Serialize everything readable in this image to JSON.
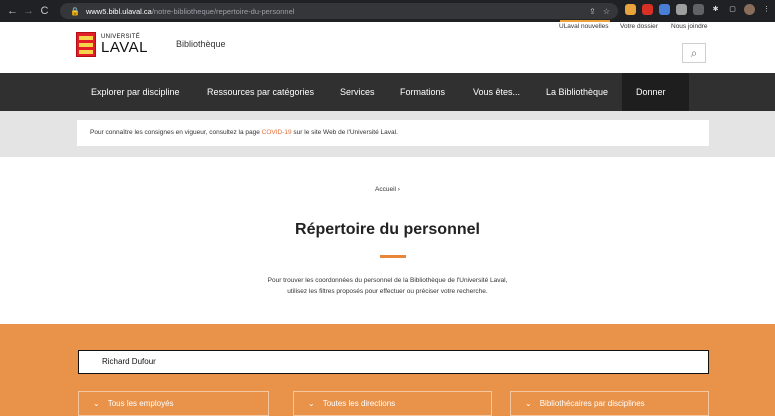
{
  "browser": {
    "url_host": "www5.bibl.ulaval.ca",
    "url_path": "/notre-bibliotheque/repertoire-du-personnel"
  },
  "utility_links": [
    "ULaval nouvelles",
    "Votre dossier",
    "Nous joindre"
  ],
  "header": {
    "logo_top": "UNIVERSITÉ",
    "logo_bottom": "LAVAL",
    "site_name": "Bibliothèque"
  },
  "nav": {
    "items": [
      "Explorer par discipline",
      "Ressources par catégories",
      "Services",
      "Formations",
      "Vous êtes...",
      "La Bibliothèque",
      "Donner"
    ]
  },
  "alert": {
    "before": "Pour connaître les consignes en vigueur, consultez la page ",
    "link": "COVID-19",
    "after": " sur le site Web de l'Université Laval."
  },
  "breadcrumb": "Accueil  ›",
  "page": {
    "title": "Répertoire du personnel",
    "intro_line1": "Pour trouver les coordonnées du personnel de la Bibliothèque de l'Université Laval,",
    "intro_line2": "utilisez les filtres proposés pour effectuer ou préciser votre recherche."
  },
  "search": {
    "value": "Richard Dufour"
  },
  "filters": [
    "Tous les employés",
    "Toutes les directions",
    "Bibliothécaires par disciplines"
  ],
  "colors": {
    "accent": "#e8924a",
    "nav_bg": "#303030",
    "link": "#e8703a"
  }
}
